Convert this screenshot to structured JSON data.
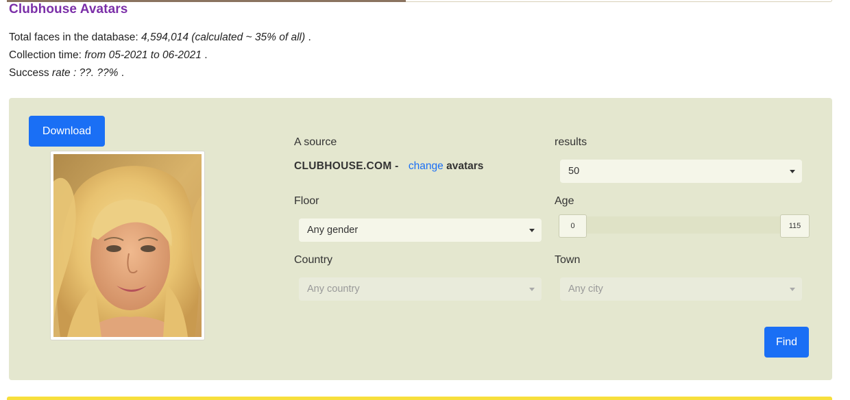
{
  "page": {
    "title": "Clubhouse Avatars"
  },
  "stats": {
    "total_label": "Total faces in the database:",
    "total_value": "4,594,014 (calculated ~ 35% of all)",
    "total_suffix": ".",
    "time_label": "Collection time:",
    "time_value": "from 05-2021 to 06-2021",
    "time_suffix": ".",
    "success_label": "Success",
    "success_rate_word": "rate",
    "success_value": ": ??. ??%",
    "success_suffix": "."
  },
  "panel": {
    "download_label": "Download",
    "source_label": "A source",
    "source_name": "CLUBHOUSE.COM -",
    "change_link": "change",
    "source_type": "avatars",
    "results_label": "results",
    "results_value": "50",
    "floor_label": "Floor",
    "gender_value": "Any gender",
    "age_label": "Age",
    "age_min": "0",
    "age_max": "115",
    "country_label": "Country",
    "country_value": "Any country",
    "town_label": "Town",
    "city_value": "Any city",
    "find_label": "Find"
  },
  "colors": {
    "title": "#7b2fa8",
    "panel_bg": "#e4e7cf",
    "primary_button": "#1a6ff5",
    "link": "#1a6ff5",
    "bottom_strip": "#f7df3c"
  },
  "icons": {
    "dropdown": "caret-down-icon",
    "photo": "face-photo"
  }
}
